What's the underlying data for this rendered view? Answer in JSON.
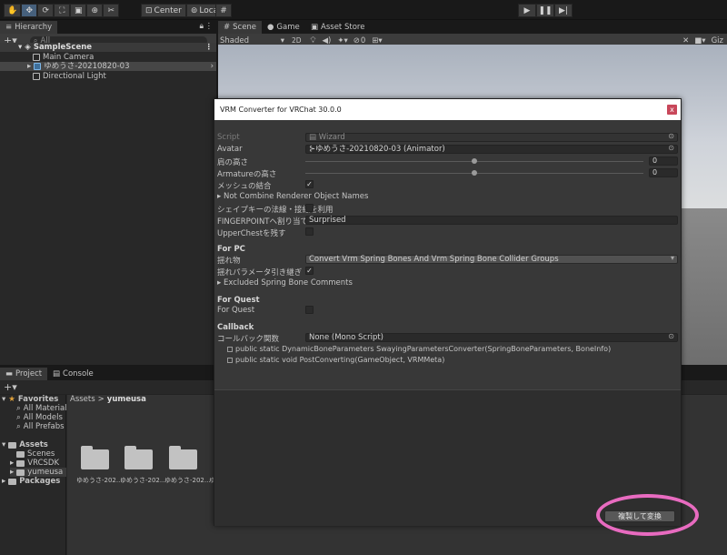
{
  "toolbar": {
    "pivot_label": "Center",
    "space_label": "Local"
  },
  "hierarchy": {
    "tab": "Hierarchy",
    "search_placeholder": "All",
    "scene": "SampleScene",
    "items": [
      {
        "label": "Main Camera"
      },
      {
        "label": "ゆめうさ-20210820-03"
      },
      {
        "label": "Directional Light"
      }
    ]
  },
  "scene_view": {
    "tabs": [
      "Scene",
      "Game",
      "Asset Store"
    ],
    "shading_mode": "Shaded",
    "mode_2d": "2D",
    "hidden_count": "0",
    "gizmos_label": "Giz"
  },
  "project": {
    "tabs": [
      "Project",
      "Console"
    ],
    "breadcrumb_root": "Assets",
    "breadcrumb_current": "yumeusa",
    "favorites_label": "Favorites",
    "favorites": [
      "All Materials",
      "All Models",
      "All Prefabs"
    ],
    "assets_label": "Assets",
    "asset_folders": [
      "Scenes",
      "VRCSDK",
      "yumeusa"
    ],
    "packages_label": "Packages",
    "grid_items": [
      "ゆめうさ-202...",
      "ゆめうさ-202...",
      "ゆめうさ-202...",
      "ゆ"
    ]
  },
  "dialog": {
    "title": "VRM Converter for VRChat 30.0.0",
    "close_label": "x",
    "script_label": "Script",
    "script_value": "Wizard",
    "avatar_label": "Avatar",
    "avatar_value": "ゆめうさ-20210820-03 (Animator)",
    "shoulder_label": "肩の高さ",
    "shoulder_value": "0",
    "shoulder_fraction": 0.5,
    "armature_label": "Armatureの高さ",
    "armature_value": "0",
    "armature_fraction": 0.5,
    "mesh_merge_label": "メッシュの結合",
    "mesh_merge_checked": true,
    "not_combine_label": "Not Combine Renderer Object Names",
    "blendshape_label": "シェイプキーの法線・接線を利用",
    "blendshape_checked": false,
    "fingerpoint_label": "FINGERPOINTへ割り当てる表",
    "fingerpoint_value": "Surprised",
    "upperchest_label": "UpperChestを残す",
    "upperchest_checked": false,
    "for_pc_header": "For PC",
    "sway_label": "揺れ物",
    "sway_value": "Convert Vrm Spring Bones And Vrm Spring Bone Collider Groups",
    "sway_param_label": "揺れパラメータ引き継ぎ",
    "sway_param_checked": true,
    "excluded_label": "Excluded Spring Bone Comments",
    "for_quest_header": "For Quest",
    "for_quest_label": "For Quest",
    "for_quest_checked": false,
    "callback_header": "Callback",
    "callback_label": "コールバック関数",
    "callback_value": "None (Mono Script)",
    "callback_line1": "public static DynamicBoneParameters SwayingParametersConverter(SpringBoneParameters, BoneInfo)",
    "callback_line2": "public static void PostConverting(GameObject, VRMMeta)",
    "convert_button": "複製して変換"
  },
  "colors": {
    "highlight": "#e86bc0",
    "close_button": "#c8475a"
  }
}
